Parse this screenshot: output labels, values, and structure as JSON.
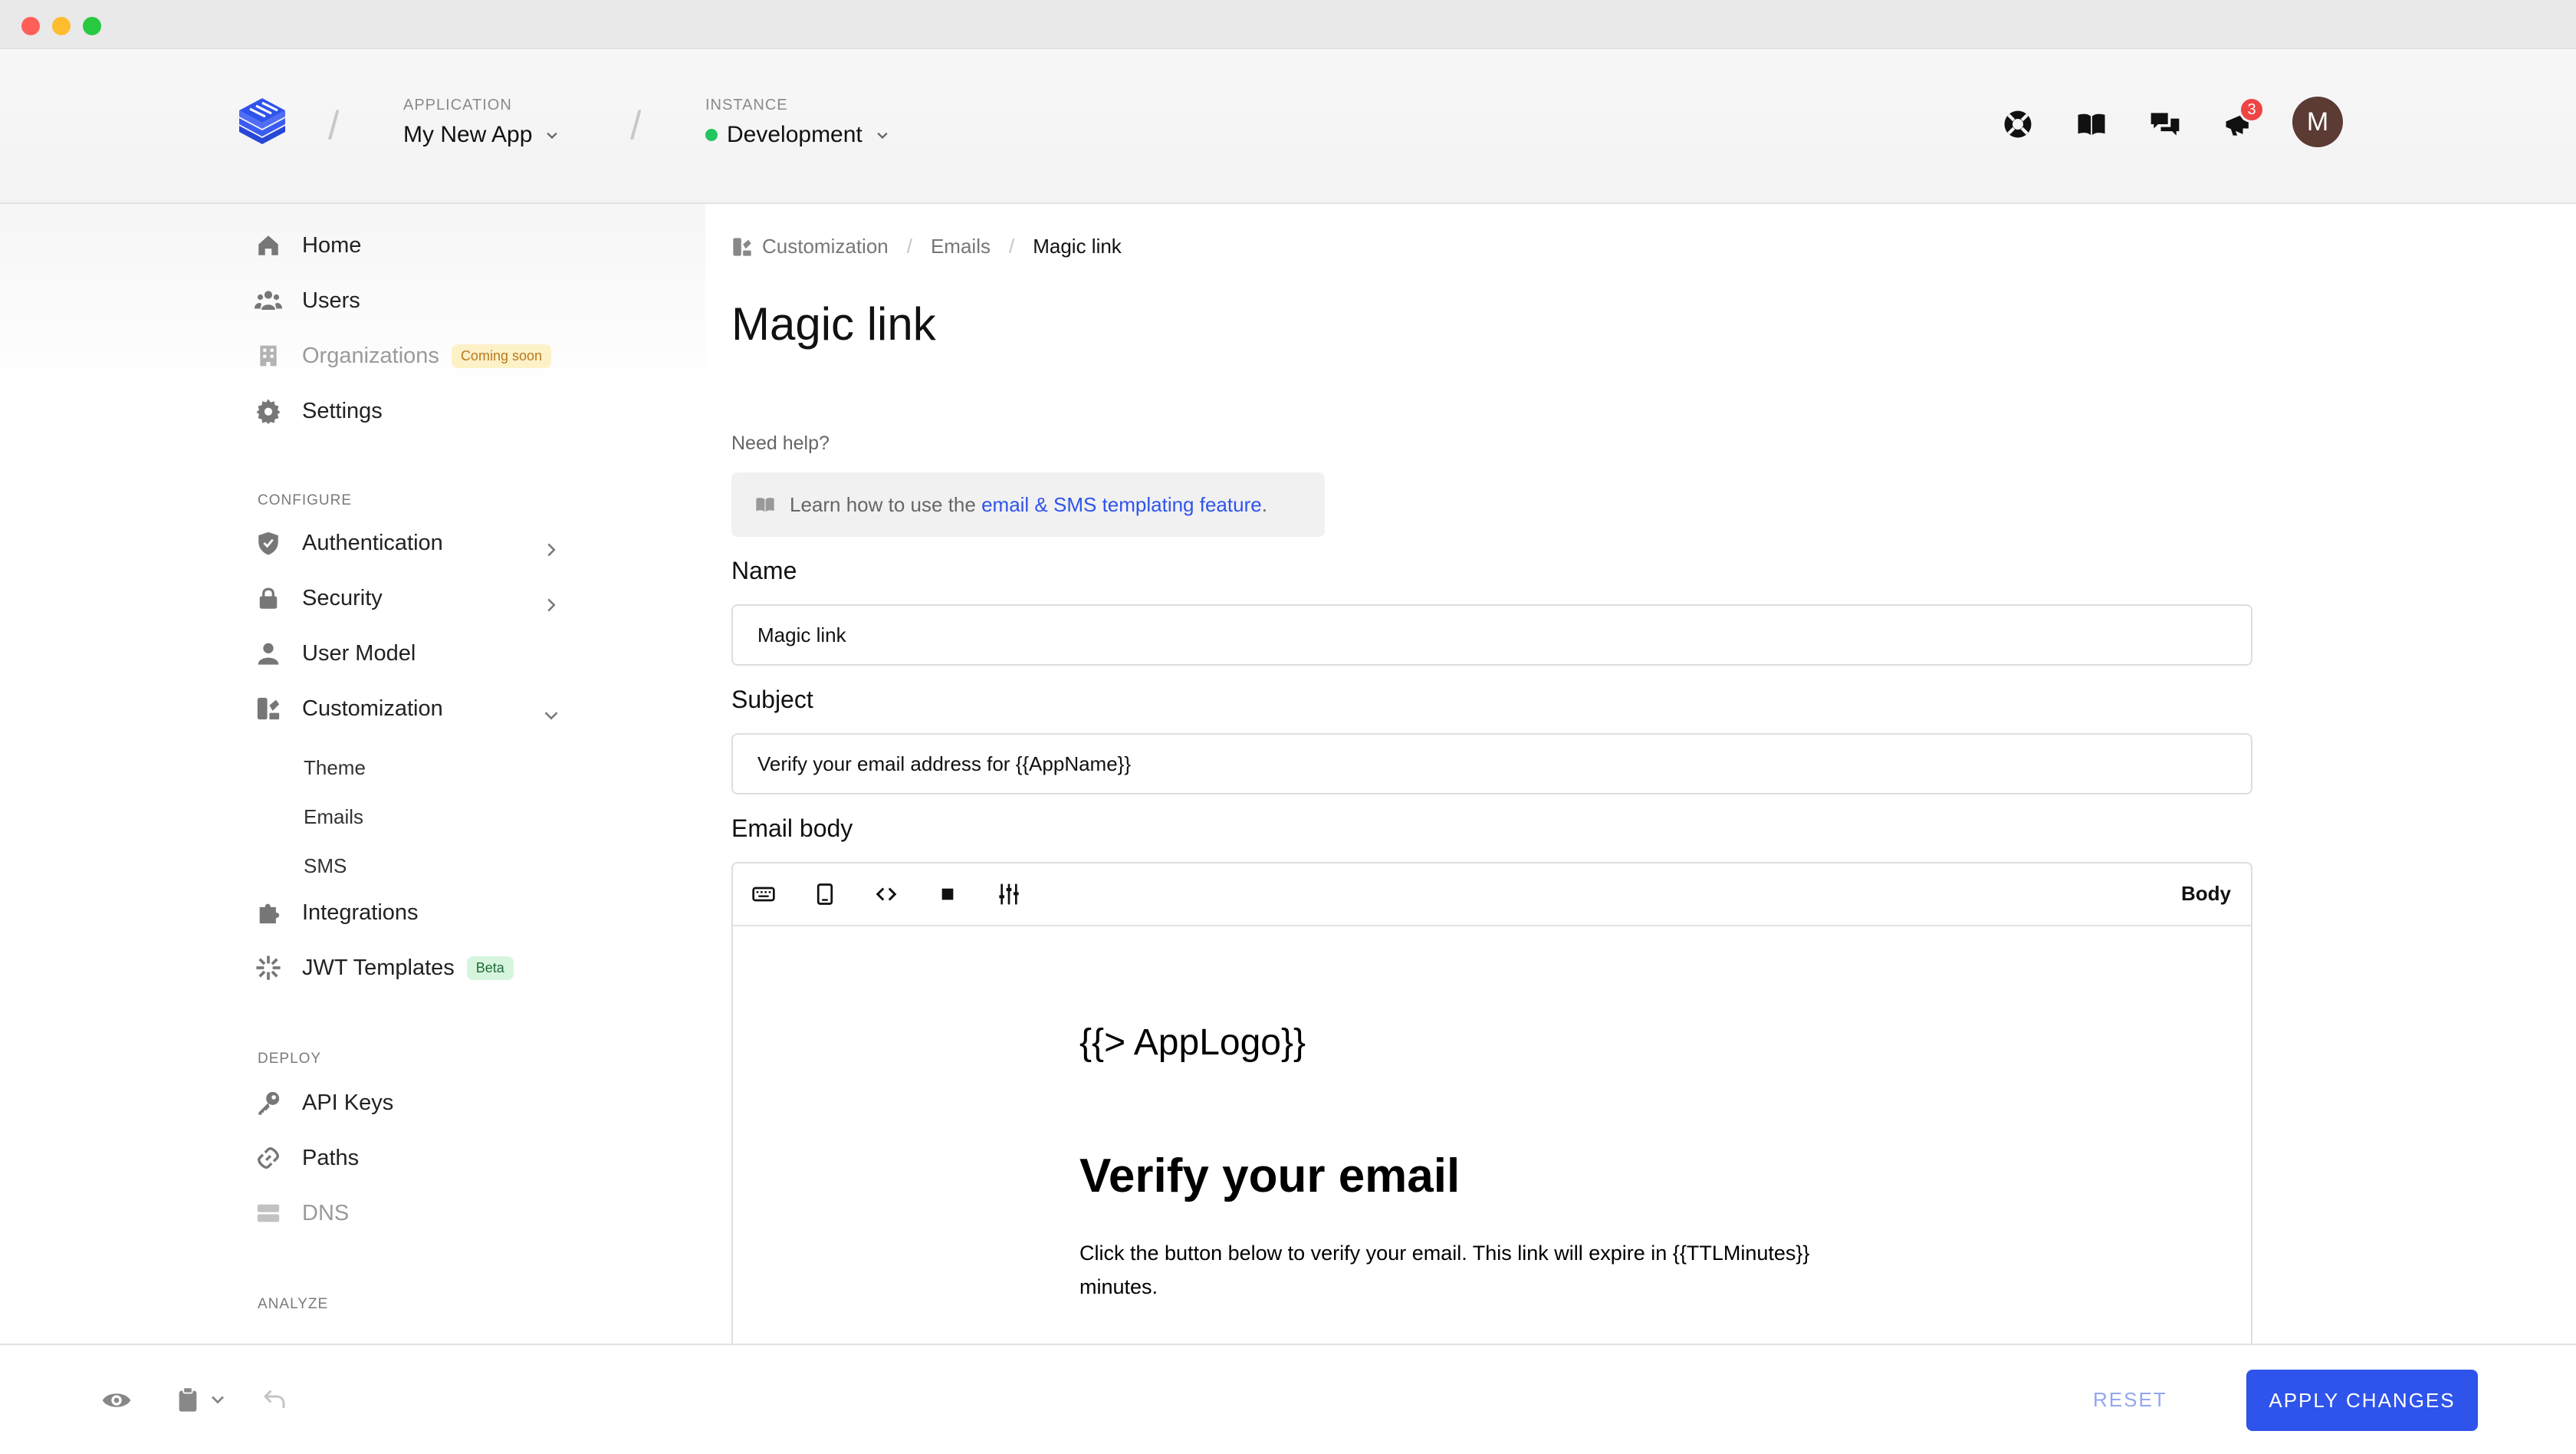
{
  "header": {
    "application_label": "APPLICATION",
    "application_name": "My New App",
    "instance_label": "INSTANCE",
    "instance_name": "Development",
    "instance_status_color": "#22c55e",
    "notification_count": "3",
    "avatar_initial": "M",
    "icons": [
      "support-icon",
      "docs-book-icon",
      "chat-icon",
      "announcements-icon"
    ]
  },
  "sidebar": {
    "items": [
      {
        "label": "Home",
        "icon": "home-icon"
      },
      {
        "label": "Users",
        "icon": "users-icon"
      },
      {
        "label": "Organizations",
        "icon": "building-icon",
        "badge": "Coming soon"
      },
      {
        "label": "Settings",
        "icon": "gear-icon"
      }
    ],
    "configure_title": "CONFIGURE",
    "configure": [
      {
        "label": "Authentication",
        "icon": "shield-icon"
      },
      {
        "label": "Security",
        "icon": "lock-icon"
      },
      {
        "label": "User Model",
        "icon": "user-icon"
      },
      {
        "label": "Customization",
        "icon": "customization-icon"
      }
    ],
    "customization_sub": [
      "Theme",
      "Emails",
      "SMS"
    ],
    "more": [
      {
        "label": "Integrations",
        "icon": "puzzle-icon"
      },
      {
        "label": "JWT Templates",
        "icon": "jwt-icon",
        "badge": "Beta"
      }
    ],
    "deploy_title": "DEPLOY",
    "deploy": [
      {
        "label": "API Keys",
        "icon": "key-icon"
      },
      {
        "label": "Paths",
        "icon": "link-icon"
      },
      {
        "label": "DNS",
        "icon": "server-icon"
      }
    ],
    "analyze_title": "ANALYZE"
  },
  "breadcrumb": [
    "Customization",
    "Emails",
    "Magic link"
  ],
  "page": {
    "title": "Magic link",
    "help_label": "Need help?",
    "help_prefix": "Learn how to use the",
    "help_link": "email & SMS templating feature",
    "help_suffix": "."
  },
  "form": {
    "name_label": "Name",
    "name_value": "Magic link",
    "subject_label": "Subject",
    "subject_value": "Verify your email address for {{AppName}}",
    "body_label": "Email body",
    "body_mode": "Body"
  },
  "preview": {
    "logo_placeholder": "{{> AppLogo}}",
    "heading": "Verify your email",
    "text": "Click the button below to verify your email. This link will expire in {{TTLMinutes}} minutes."
  },
  "footer": {
    "reset_label": "RESET",
    "apply_label": "APPLY CHANGES",
    "accent_color": "#2f54eb"
  }
}
